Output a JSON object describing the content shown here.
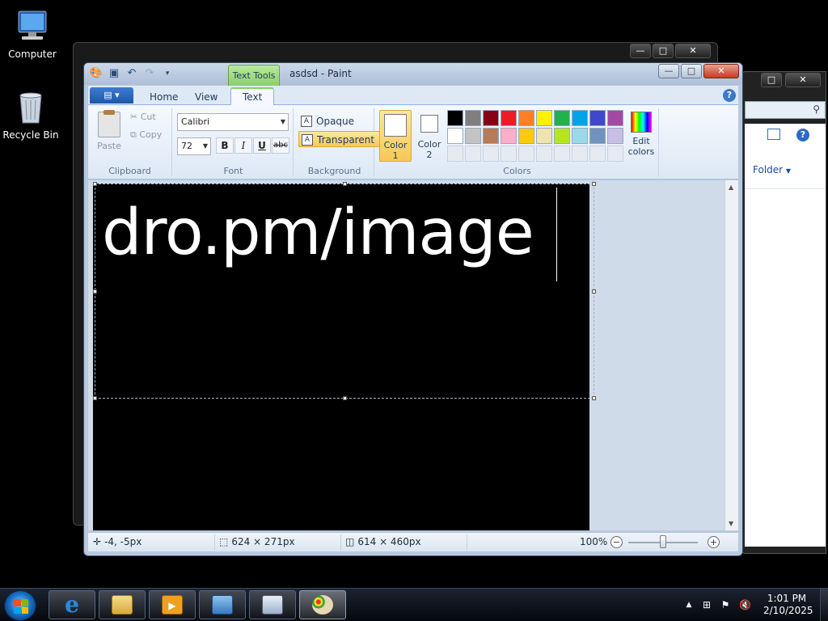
{
  "desktop": {
    "icons": [
      {
        "label": "Computer"
      },
      {
        "label": "Recycle Bin"
      }
    ]
  },
  "explorer_right": {
    "folder_label": "Folder",
    "help": "?"
  },
  "paint": {
    "title": "asdsd - Paint",
    "context_tab": "Text Tools",
    "tabs": [
      {
        "label": "Home"
      },
      {
        "label": "View"
      },
      {
        "label": "Text",
        "active": true
      }
    ],
    "help": "?",
    "clipboard": {
      "paste": "Paste",
      "cut": "Cut",
      "copy": "Copy",
      "label": "Clipboard"
    },
    "font": {
      "family": "Calibri",
      "size": "72",
      "bold": "B",
      "italic": "I",
      "underline": "U",
      "strikethrough": "abc",
      "label": "Font"
    },
    "background": {
      "opaque": "Opaque",
      "transparent": "Transparent",
      "label": "Background"
    },
    "colors": {
      "color1_label": "Color",
      "color1_num": "1",
      "color2_label": "Color",
      "color2_num": "2",
      "edit_label": "Edit",
      "edit_label2": "colors",
      "label": "Colors",
      "row1": [
        "#000000",
        "#7f7f7f",
        "#880015",
        "#ed1c24",
        "#ff7f27",
        "#fff200",
        "#22b14c",
        "#00a2e8",
        "#3f48cc",
        "#a349a4"
      ],
      "row2": [
        "#ffffff",
        "#c3c3c3",
        "#b97a57",
        "#ffaec9",
        "#ffc90e",
        "#efe4b0",
        "#b5e61d",
        "#99d9ea",
        "#7092be",
        "#c8bfe7"
      ]
    },
    "canvas": {
      "text": "dro.pm/image"
    },
    "status": {
      "cursor_pos": "-4, -5px",
      "selection_size": "624 × 271px",
      "image_size": "614 × 460px",
      "zoom": "100%",
      "zoom_level": 1.0
    }
  },
  "taskbar": {
    "time": "1:01 PM",
    "date": "2/10/2025"
  }
}
